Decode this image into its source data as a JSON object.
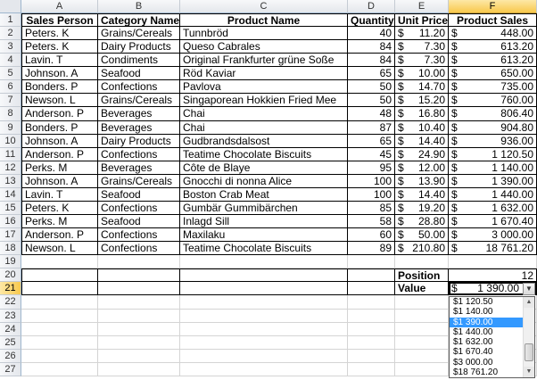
{
  "columns": [
    "A",
    "B",
    "C",
    "D",
    "E",
    "F"
  ],
  "rows": [
    "1",
    "2",
    "3",
    "4",
    "5",
    "6",
    "7",
    "8",
    "9",
    "10",
    "11",
    "12",
    "13",
    "14",
    "15",
    "16",
    "17",
    "18",
    "19",
    "20",
    "21",
    "22",
    "23",
    "24",
    "25",
    "26",
    "27"
  ],
  "headers": {
    "sales_person": "Sales Person",
    "category": "Category Name",
    "product": "Product Name",
    "quantity": "Quantity",
    "unit_price": "Unit Price",
    "product_sales": "Product Sales"
  },
  "currency_symbol": "$",
  "table": [
    [
      "Peters. K",
      "Grains/Cereals",
      "Tunnbröd",
      "40",
      "11.20",
      "448.00"
    ],
    [
      "Peters. K",
      "Dairy Products",
      "Queso Cabrales",
      "84",
      "7.30",
      "613.20"
    ],
    [
      "Lavin. T",
      "Condiments",
      "Original Frankfurter grüne Soße",
      "84",
      "7.30",
      "613.20"
    ],
    [
      "Johnson. A",
      "Seafood",
      "Röd Kaviar",
      "65",
      "10.00",
      "650.00"
    ],
    [
      "Bonders. P",
      "Confections",
      "Pavlova",
      "50",
      "14.70",
      "735.00"
    ],
    [
      "Newson. L",
      "Grains/Cereals",
      "Singaporean Hokkien Fried Mee",
      "50",
      "15.20",
      "760.00"
    ],
    [
      "Anderson. P",
      "Beverages",
      "Chai",
      "48",
      "16.80",
      "806.40"
    ],
    [
      "Bonders. P",
      "Beverages",
      "Chai",
      "87",
      "10.40",
      "904.80"
    ],
    [
      "Johnson. A",
      "Dairy Products",
      "Gudbrandsdalsost",
      "65",
      "14.40",
      "936.00"
    ],
    [
      "Anderson. P",
      "Confections",
      "Teatime Chocolate Biscuits",
      "45",
      "24.90",
      "1 120.50"
    ],
    [
      "Perks. M",
      "Beverages",
      "Côte de Blaye",
      "95",
      "12.00",
      "1 140.00"
    ],
    [
      "Johnson. A",
      "Grains/Cereals",
      "Gnocchi di nonna Alice",
      "100",
      "13.90",
      "1 390.00"
    ],
    [
      "Lavin. T",
      "Seafood",
      "Boston Crab Meat",
      "100",
      "14.40",
      "1 440.00"
    ],
    [
      "Peters. K",
      "Confections",
      "Gumbär Gummibärchen",
      "85",
      "19.20",
      "1 632.00"
    ],
    [
      "Perks. M",
      "Seafood",
      "Inlagd Sill",
      "58",
      "28.80",
      "1 670.40"
    ],
    [
      "Anderson. P",
      "Confections",
      "Maxilaku",
      "60",
      "50.00",
      "3 000.00"
    ],
    [
      "Newson. L",
      "Confections",
      "Teatime Chocolate Biscuits",
      "89",
      "210.80",
      "18 761.20"
    ]
  ],
  "position": {
    "label": "Position",
    "value": "12"
  },
  "value_row": {
    "label": "Value",
    "value": "1 390.00"
  },
  "dropdown": {
    "items": [
      "$1 120.50",
      "$1 140.00",
      "$1 390.00",
      "$1 440.00",
      "$1 632.00",
      "$1 670.40",
      "$3 000.00",
      "$18 761.20"
    ],
    "selected_index": 2
  }
}
